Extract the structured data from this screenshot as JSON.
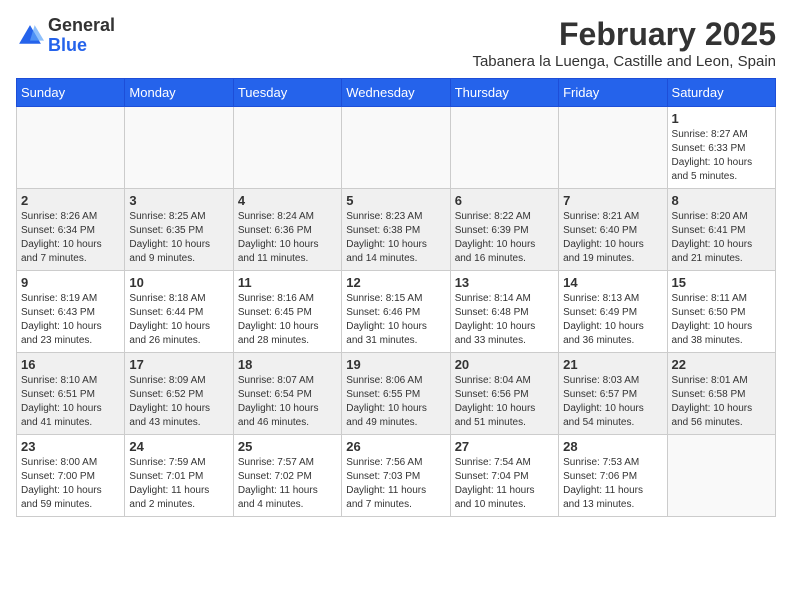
{
  "header": {
    "logo_general": "General",
    "logo_blue": "Blue",
    "title": "February 2025",
    "subtitle": "Tabanera la Luenga, Castille and Leon, Spain"
  },
  "days_of_week": [
    "Sunday",
    "Monday",
    "Tuesday",
    "Wednesday",
    "Thursday",
    "Friday",
    "Saturday"
  ],
  "weeks": [
    [
      {
        "day": "",
        "info": ""
      },
      {
        "day": "",
        "info": ""
      },
      {
        "day": "",
        "info": ""
      },
      {
        "day": "",
        "info": ""
      },
      {
        "day": "",
        "info": ""
      },
      {
        "day": "",
        "info": ""
      },
      {
        "day": "1",
        "info": "Sunrise: 8:27 AM\nSunset: 6:33 PM\nDaylight: 10 hours\nand 5 minutes."
      }
    ],
    [
      {
        "day": "2",
        "info": "Sunrise: 8:26 AM\nSunset: 6:34 PM\nDaylight: 10 hours\nand 7 minutes."
      },
      {
        "day": "3",
        "info": "Sunrise: 8:25 AM\nSunset: 6:35 PM\nDaylight: 10 hours\nand 9 minutes."
      },
      {
        "day": "4",
        "info": "Sunrise: 8:24 AM\nSunset: 6:36 PM\nDaylight: 10 hours\nand 11 minutes."
      },
      {
        "day": "5",
        "info": "Sunrise: 8:23 AM\nSunset: 6:38 PM\nDaylight: 10 hours\nand 14 minutes."
      },
      {
        "day": "6",
        "info": "Sunrise: 8:22 AM\nSunset: 6:39 PM\nDaylight: 10 hours\nand 16 minutes."
      },
      {
        "day": "7",
        "info": "Sunrise: 8:21 AM\nSunset: 6:40 PM\nDaylight: 10 hours\nand 19 minutes."
      },
      {
        "day": "8",
        "info": "Sunrise: 8:20 AM\nSunset: 6:41 PM\nDaylight: 10 hours\nand 21 minutes."
      }
    ],
    [
      {
        "day": "9",
        "info": "Sunrise: 8:19 AM\nSunset: 6:43 PM\nDaylight: 10 hours\nand 23 minutes."
      },
      {
        "day": "10",
        "info": "Sunrise: 8:18 AM\nSunset: 6:44 PM\nDaylight: 10 hours\nand 26 minutes."
      },
      {
        "day": "11",
        "info": "Sunrise: 8:16 AM\nSunset: 6:45 PM\nDaylight: 10 hours\nand 28 minutes."
      },
      {
        "day": "12",
        "info": "Sunrise: 8:15 AM\nSunset: 6:46 PM\nDaylight: 10 hours\nand 31 minutes."
      },
      {
        "day": "13",
        "info": "Sunrise: 8:14 AM\nSunset: 6:48 PM\nDaylight: 10 hours\nand 33 minutes."
      },
      {
        "day": "14",
        "info": "Sunrise: 8:13 AM\nSunset: 6:49 PM\nDaylight: 10 hours\nand 36 minutes."
      },
      {
        "day": "15",
        "info": "Sunrise: 8:11 AM\nSunset: 6:50 PM\nDaylight: 10 hours\nand 38 minutes."
      }
    ],
    [
      {
        "day": "16",
        "info": "Sunrise: 8:10 AM\nSunset: 6:51 PM\nDaylight: 10 hours\nand 41 minutes."
      },
      {
        "day": "17",
        "info": "Sunrise: 8:09 AM\nSunset: 6:52 PM\nDaylight: 10 hours\nand 43 minutes."
      },
      {
        "day": "18",
        "info": "Sunrise: 8:07 AM\nSunset: 6:54 PM\nDaylight: 10 hours\nand 46 minutes."
      },
      {
        "day": "19",
        "info": "Sunrise: 8:06 AM\nSunset: 6:55 PM\nDaylight: 10 hours\nand 49 minutes."
      },
      {
        "day": "20",
        "info": "Sunrise: 8:04 AM\nSunset: 6:56 PM\nDaylight: 10 hours\nand 51 minutes."
      },
      {
        "day": "21",
        "info": "Sunrise: 8:03 AM\nSunset: 6:57 PM\nDaylight: 10 hours\nand 54 minutes."
      },
      {
        "day": "22",
        "info": "Sunrise: 8:01 AM\nSunset: 6:58 PM\nDaylight: 10 hours\nand 56 minutes."
      }
    ],
    [
      {
        "day": "23",
        "info": "Sunrise: 8:00 AM\nSunset: 7:00 PM\nDaylight: 10 hours\nand 59 minutes."
      },
      {
        "day": "24",
        "info": "Sunrise: 7:59 AM\nSunset: 7:01 PM\nDaylight: 11 hours\nand 2 minutes."
      },
      {
        "day": "25",
        "info": "Sunrise: 7:57 AM\nSunset: 7:02 PM\nDaylight: 11 hours\nand 4 minutes."
      },
      {
        "day": "26",
        "info": "Sunrise: 7:56 AM\nSunset: 7:03 PM\nDaylight: 11 hours\nand 7 minutes."
      },
      {
        "day": "27",
        "info": "Sunrise: 7:54 AM\nSunset: 7:04 PM\nDaylight: 11 hours\nand 10 minutes."
      },
      {
        "day": "28",
        "info": "Sunrise: 7:53 AM\nSunset: 7:06 PM\nDaylight: 11 hours\nand 13 minutes."
      },
      {
        "day": "",
        "info": ""
      }
    ]
  ]
}
